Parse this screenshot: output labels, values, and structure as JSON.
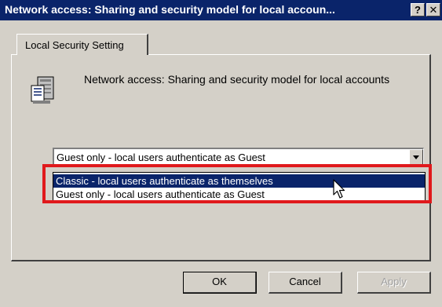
{
  "window": {
    "title": "Network access: Sharing and security model for local accoun...",
    "help_button": "?",
    "close_button": "✕"
  },
  "tabs": [
    {
      "label": "Local Security Setting"
    }
  ],
  "setting": {
    "icon": "security-policy-icon",
    "description": "Network access: Sharing and security model for local accounts"
  },
  "combo": {
    "selected_value": "Guest only - local users authenticate as Guest",
    "options": [
      "Classic - local users authenticate as themselves",
      "Guest only - local users authenticate as Guest"
    ],
    "highlighted_option": "Classic - local users authenticate as themselves"
  },
  "annotation": {
    "highlight_color": "#e0191c"
  },
  "buttons": {
    "ok": "OK",
    "cancel": "Cancel",
    "apply": "Apply"
  },
  "colors": {
    "titlebar": "#0a246a",
    "selection": "#0a246a",
    "face": "#d4d0c8"
  }
}
